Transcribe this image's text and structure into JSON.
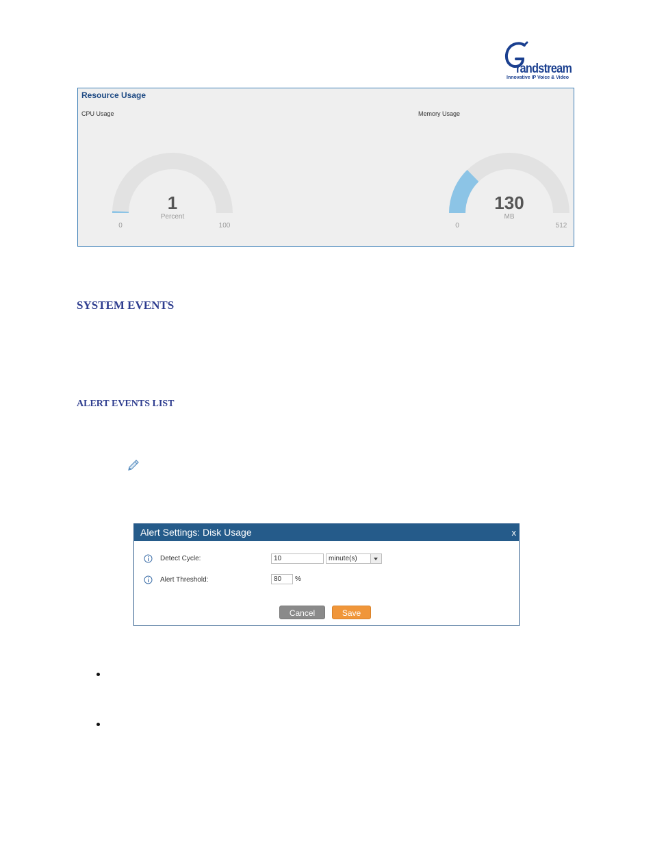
{
  "logo": {
    "brand": "Grandstream",
    "wordmark": "randstream",
    "tagline": "Innovative IP Voice & Video"
  },
  "resource_usage": {
    "title": "Resource Usage",
    "cpu": {
      "label": "CPU Usage",
      "value": "1",
      "unit": "Percent",
      "min": "0",
      "max": "100",
      "fraction": 0.01
    },
    "memory": {
      "label": "Memory Usage",
      "value": "130",
      "unit": "MB",
      "min": "0",
      "max": "512",
      "fraction": 0.254
    },
    "colors": {
      "track": "#e2e2e2",
      "fill": "#8cc4e6",
      "panel_bg": "#efefef",
      "border": "#3d7fb6"
    }
  },
  "headings": {
    "system_events": "SYSTEM EVENTS",
    "alert_events_list": "ALERT EVENTS LIST"
  },
  "edit_icon": "pencil-icon",
  "dialog": {
    "title": "Alert Settings: Disk Usage",
    "close": "x",
    "detect_cycle": {
      "label": "Detect Cycle:",
      "value": "10",
      "unit_selected": "minute(s)"
    },
    "alert_threshold": {
      "label": "Alert Threshold:",
      "value": "80",
      "unit": "%"
    },
    "cancel_label": "Cancel",
    "save_label": "Save",
    "colors": {
      "header": "#255b8a",
      "save": "#f0963a",
      "cancel": "#8a8a8a"
    }
  }
}
